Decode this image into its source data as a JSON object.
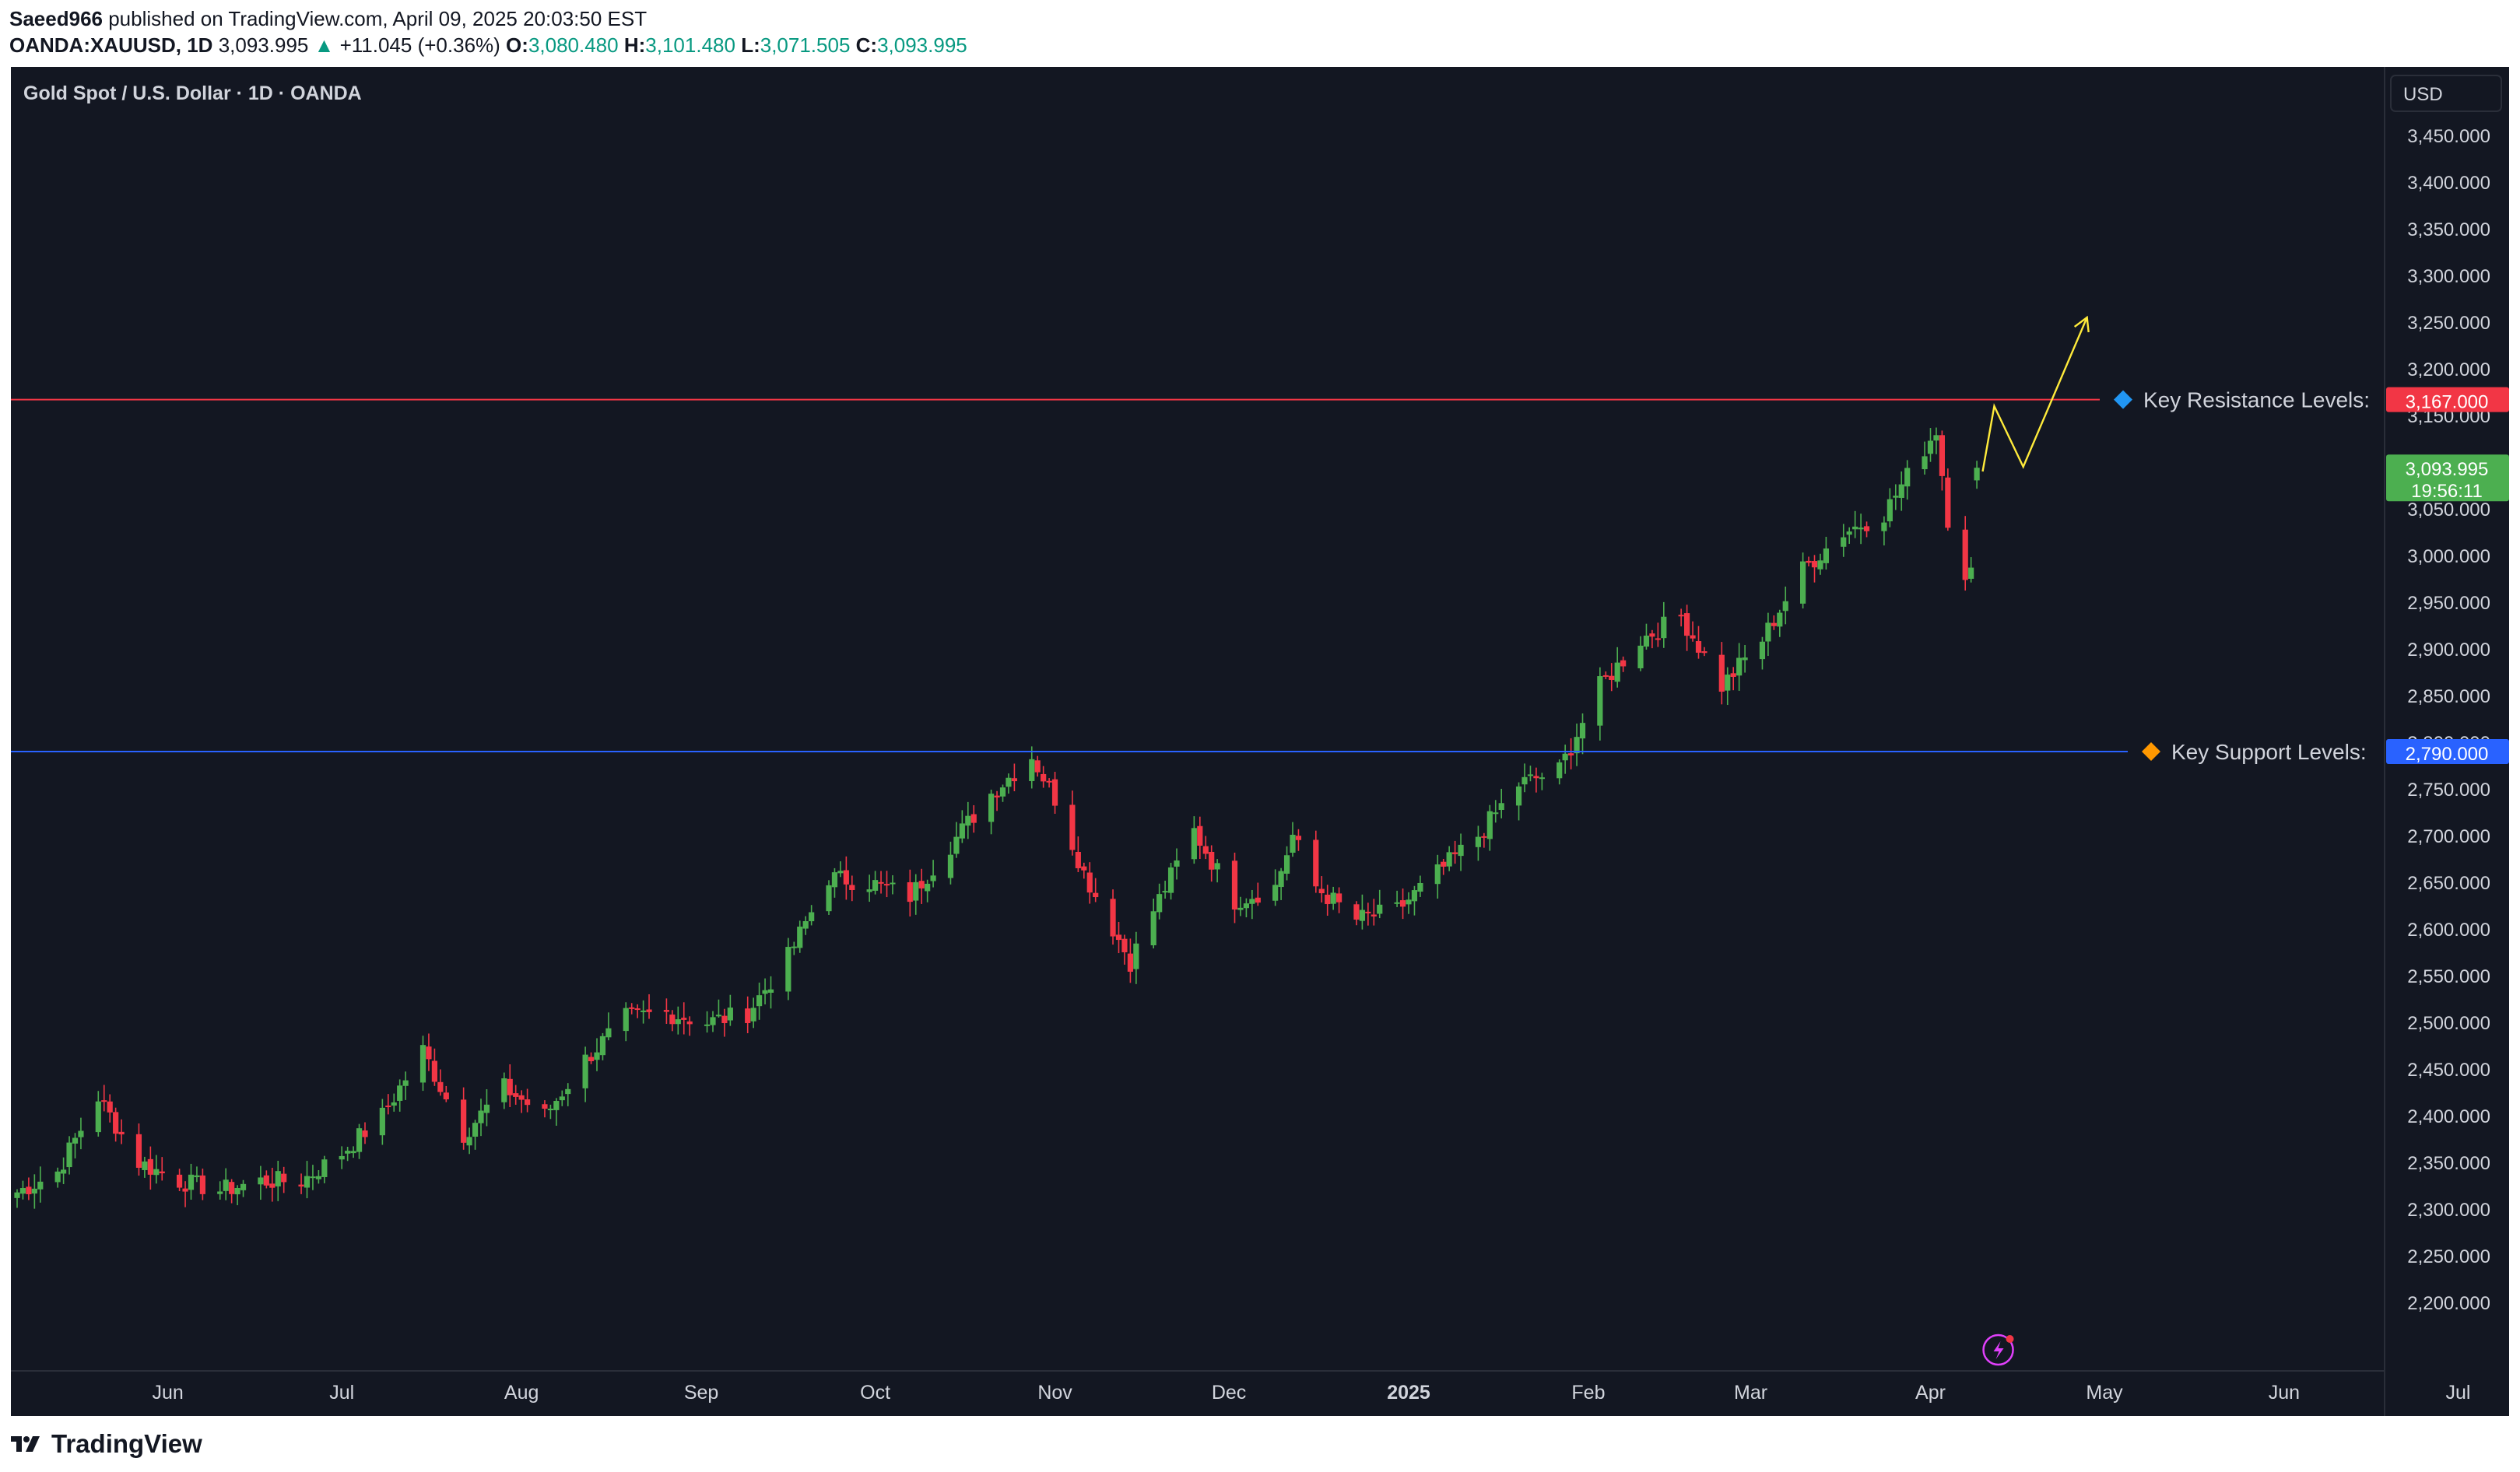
{
  "publish": {
    "author": "Saeed966",
    "text": "published on TradingView.com, April 09, 2025 20:03:50 EST"
  },
  "ticker": {
    "symbol": "OANDA:XAUUSD, 1D",
    "last": "3,093.995",
    "change_arrow": "▲",
    "change": "+11.045 (+0.36%)",
    "o_label": "O:",
    "o": "3,080.480",
    "h_label": "H:",
    "h": "3,101.480",
    "l_label": "L:",
    "l": "3,071.505",
    "c_label": "C:",
    "c": "3,093.995"
  },
  "legend": {
    "title": "Gold Spot / U.S. Dollar · 1D · OANDA"
  },
  "currency_button": "USD",
  "footer": {
    "brand": "TradingView",
    "logo_icon": "tradingview-logo-icon"
  },
  "colors": {
    "background": "#131722",
    "up": "#4caf50",
    "down": "#f23645",
    "resistance": "#f23645",
    "support": "#2962ff",
    "projection": "#ffeb3b",
    "last_price": "#4caf50",
    "text": "#d1d4dc"
  },
  "chart_data": {
    "type": "candlestick",
    "title": "Gold Spot / U.S. Dollar · 1D · OANDA",
    "x_axis": {
      "labels": [
        "Jun",
        "Jul",
        "Aug",
        "Sep",
        "Oct",
        "Nov",
        "Dec",
        "2025",
        "Feb",
        "Mar",
        "Apr",
        "May",
        "Jun",
        "Jul"
      ],
      "bold_label": "2025",
      "range": [
        "2024-05-06",
        "2025-07-28"
      ]
    },
    "y_axis": {
      "ticks": [
        "3,450.000",
        "3,400.000",
        "3,350.000",
        "3,300.000",
        "3,250.000",
        "3,200.000",
        "3,150.000",
        "3,100.000",
        "3,050.000",
        "3,000.000",
        "2,950.000",
        "2,900.000",
        "2,850.000",
        "2,800.000",
        "2,750.000",
        "2,700.000",
        "2,650.000",
        "2,600.000",
        "2,550.000",
        "2,500.000",
        "2,450.000",
        "2,400.000",
        "2,350.000",
        "2,300.000",
        "2,250.000",
        "2,200.000"
      ],
      "tick_values": [
        3450,
        3400,
        3350,
        3300,
        3250,
        3200,
        3150,
        3100,
        3050,
        3000,
        2950,
        2900,
        2850,
        2800,
        2750,
        2700,
        2650,
        2600,
        2550,
        2500,
        2450,
        2400,
        2350,
        2300,
        2250,
        2200
      ],
      "range": [
        2150,
        3500
      ],
      "side": "right"
    },
    "series_close_anchors": [
      [
        "2024-05-06",
        2318
      ],
      [
        "2024-05-13",
        2340
      ],
      [
        "2024-05-20",
        2420
      ],
      [
        "2024-05-27",
        2350
      ],
      [
        "2024-06-03",
        2330
      ],
      [
        "2024-06-10",
        2320
      ],
      [
        "2024-06-17",
        2330
      ],
      [
        "2024-06-24",
        2330
      ],
      [
        "2024-07-01",
        2360
      ],
      [
        "2024-07-08",
        2400
      ],
      [
        "2024-07-15",
        2470
      ],
      [
        "2024-07-22",
        2380
      ],
      [
        "2024-07-29",
        2430
      ],
      [
        "2024-08-05",
        2400
      ],
      [
        "2024-08-12",
        2460
      ],
      [
        "2024-08-19",
        2505
      ],
      [
        "2024-08-26",
        2510
      ],
      [
        "2024-09-02",
        2500
      ],
      [
        "2024-09-09",
        2510
      ],
      [
        "2024-09-16",
        2570
      ],
      [
        "2024-09-23",
        2655
      ],
      [
        "2024-09-30",
        2650
      ],
      [
        "2024-10-07",
        2635
      ],
      [
        "2024-10-14",
        2690
      ],
      [
        "2024-10-21",
        2745
      ],
      [
        "2024-10-28",
        2785
      ],
      [
        "2024-11-01",
        2740
      ],
      [
        "2024-11-06",
        2660
      ],
      [
        "2024-11-14",
        2565
      ],
      [
        "2024-11-18",
        2620
      ],
      [
        "2024-11-25",
        2705
      ],
      [
        "2024-12-02",
        2630
      ],
      [
        "2024-12-09",
        2645
      ],
      [
        "2024-12-12",
        2700
      ],
      [
        "2024-12-16",
        2645
      ],
      [
        "2024-12-23",
        2610
      ],
      [
        "2024-12-30",
        2620
      ],
      [
        "2025-01-06",
        2660
      ],
      [
        "2025-01-13",
        2700
      ],
      [
        "2025-01-20",
        2755
      ],
      [
        "2025-01-27",
        2770
      ],
      [
        "2025-02-03",
        2860
      ],
      [
        "2025-02-10",
        2910
      ],
      [
        "2025-02-17",
        2935
      ],
      [
        "2025-02-24",
        2860
      ],
      [
        "2025-03-03",
        2910
      ],
      [
        "2025-03-10",
        2985
      ],
      [
        "2025-03-17",
        3025
      ],
      [
        "2025-03-24",
        3045
      ],
      [
        "2025-03-28",
        3085
      ],
      [
        "2025-04-02",
        3135
      ],
      [
        "2025-04-04",
        3040
      ],
      [
        "2025-04-07",
        2982
      ],
      [
        "2025-04-08",
        2982
      ],
      [
        "2025-04-09",
        3094
      ]
    ],
    "last_candle": {
      "date": "2025-04-09",
      "open": 3080.48,
      "high": 3101.48,
      "low": 3071.505,
      "close": 3093.995
    },
    "horizontal_lines": [
      {
        "name": "resistance",
        "value": 3167,
        "label": "Key Resistance Levels:",
        "price_tag": "3,167.000",
        "marker": "blue-diamond"
      },
      {
        "name": "support",
        "value": 2790,
        "label": "Key Support Levels:",
        "price_tag": "2,790.000",
        "marker": "orange-diamond"
      }
    ],
    "last_price_tag": {
      "price": "3,093.995",
      "countdown": "19:56:11"
    },
    "projection": {
      "points": [
        [
          "2025-04-10",
          3090
        ],
        [
          "2025-04-12",
          3160
        ],
        [
          "2025-04-17",
          3095
        ],
        [
          "2025-04-28",
          3255
        ]
      ],
      "arrow": "up"
    },
    "event_marker": {
      "date": "2025-04-10",
      "icon": "lightning-icon"
    }
  }
}
